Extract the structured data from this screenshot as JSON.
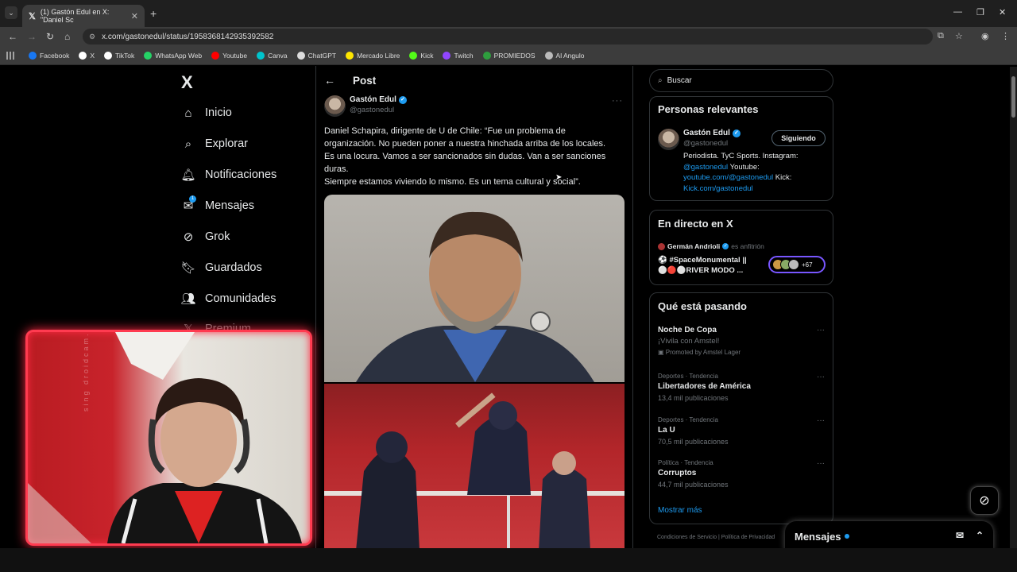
{
  "browser": {
    "tab_title": "(1) Gastón Edul en X: \"Daniel Sc",
    "url": "x.com/gastonedul/status/1958368142935392582",
    "bookmarks": [
      {
        "label": "Facebook",
        "color": "#1877f2"
      },
      {
        "label": "X",
        "color": "#ffffff"
      },
      {
        "label": "TikTok",
        "color": "#ffffff"
      },
      {
        "label": "WhatsApp Web",
        "color": "#25d366"
      },
      {
        "label": "Youtube",
        "color": "#ff0000"
      },
      {
        "label": "Canva",
        "color": "#00c4cc"
      },
      {
        "label": "ChatGPT",
        "color": "#dddddd"
      },
      {
        "label": "Mercado Libre",
        "color": "#ffe600"
      },
      {
        "label": "Kick",
        "color": "#53fc18"
      },
      {
        "label": "Twitch",
        "color": "#9146ff"
      },
      {
        "label": "PROMIEDOS",
        "color": "#2e9e3e"
      },
      {
        "label": "Al Angulo",
        "color": "#bbbbbb"
      }
    ]
  },
  "nav": {
    "logo": "X",
    "items": [
      {
        "label": "Inicio",
        "icon": "home-icon"
      },
      {
        "label": "Explorar",
        "icon": "search-icon"
      },
      {
        "label": "Notificaciones",
        "icon": "bell-icon"
      },
      {
        "label": "Mensajes",
        "icon": "mail-icon",
        "badge": "1"
      },
      {
        "label": "Grok",
        "icon": "grok-icon"
      },
      {
        "label": "Guardados",
        "icon": "bookmark-icon"
      },
      {
        "label": "Comunidades",
        "icon": "people-icon"
      },
      {
        "label": "Premium",
        "icon": "x-icon"
      }
    ]
  },
  "post": {
    "header": "Post",
    "author_name": "Gastón Edul",
    "author_handle": "@gastonedul",
    "text_lines": [
      "Daniel Schapira, dirigente de U de Chile: “Fue un problema de",
      "organización. No pueden poner a nuestra hinchada arriba de los locales.",
      "Es una locura. Vamos a ser sancionados sin dudas. Van a ser sanciones",
      "duras.",
      "Siempre estamos viviendo lo mismo. Es un tema cultural y social”."
    ]
  },
  "right": {
    "search_placeholder": "Buscar",
    "relevant_title": "Personas relevantes",
    "relevant_person": {
      "name": "Gastón Edul",
      "handle": "@gastonedul",
      "follow_label": "Siguiendo",
      "bio_1": "Periodista. TyC Sports. Instagram:",
      "bio_link1": "@gastonedul",
      "bio_2": " Youtube:",
      "bio_link2": "youtube.com/@gastonedul",
      "bio_3": " Kick:",
      "bio_link3": "Kick.com/gastonedul"
    },
    "live_title": "En directo en X",
    "live": {
      "host": "Germán Andrioli",
      "host_role": "es anfitrión",
      "line1": "⚽ #SpaceMonumental ||",
      "line2": "⚪🔴⚪RIVER MODO ...",
      "count": "+67"
    },
    "trends_title": "Qué está pasando",
    "trends": [
      {
        "meta": "",
        "name": "Noche De Copa",
        "sub": "¡Vivila con Amstel!",
        "promo": "Promoted by Amstel Lager"
      },
      {
        "meta": "Deportes · Tendencia",
        "name": "Libertadores de América",
        "sub": "13,4 mil publicaciones"
      },
      {
        "meta": "Deportes · Tendencia",
        "name": "La U",
        "sub": "70,5 mil publicaciones"
      },
      {
        "meta": "Política · Tendencia",
        "name": "Corruptos",
        "sub": "44,7 mil publicaciones"
      }
    ],
    "show_more": "Mostrar más",
    "footer": "Condiciones de Servicio  |  Política de Privacidad"
  },
  "messages_dock": {
    "label": "Mensajes"
  },
  "webcam": {
    "watermark": "sing droidcam.app"
  }
}
